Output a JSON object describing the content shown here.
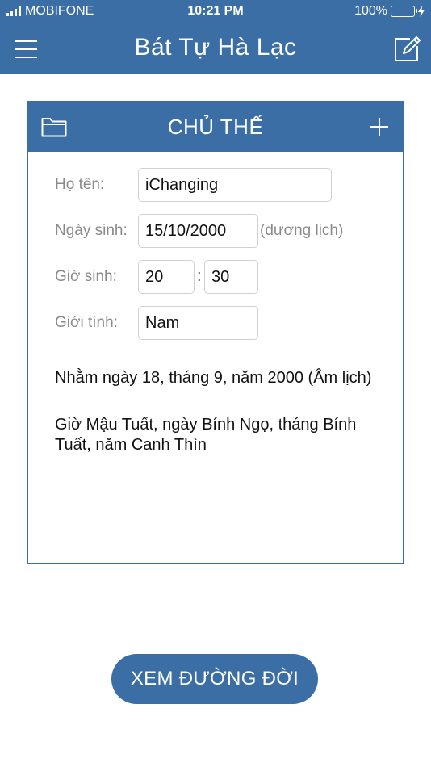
{
  "colors": {
    "brand": "#3a6ea5",
    "battery": "#4cd964"
  },
  "status_bar": {
    "carrier": "MOBIFONE",
    "time": "10:21 PM",
    "battery": "100%"
  },
  "header": {
    "title": "Bát Tự Hà Lạc",
    "menu_icon": "menu-icon",
    "edit_icon": "edit-icon"
  },
  "card": {
    "title": "CHỦ THẾ",
    "folder_icon": "folder-icon",
    "add_icon": "plus-icon",
    "name_label": "Họ tên:",
    "name_value": "iChanging",
    "dob_label": "Ngày sinh:",
    "dob_value": "15/10/2000",
    "dob_note": "(dương lịch)",
    "time_label": "Giờ sinh:",
    "hour_value": "20",
    "time_sep": ":",
    "minute_value": "30",
    "gender_label": "Giới tính:",
    "gender_value": "Nam",
    "lunar_info": "Nhằm ngày 18, tháng 9, năm 2000 (Âm lịch)",
    "canchi_line1": "Giờ Mậu Tuất, ngày Bính Ngọ, tháng Bính",
    "canchi_line2": "Tuất, năm Canh Thìn"
  },
  "action": {
    "label": "XEM ĐƯỜNG ĐỜI"
  }
}
